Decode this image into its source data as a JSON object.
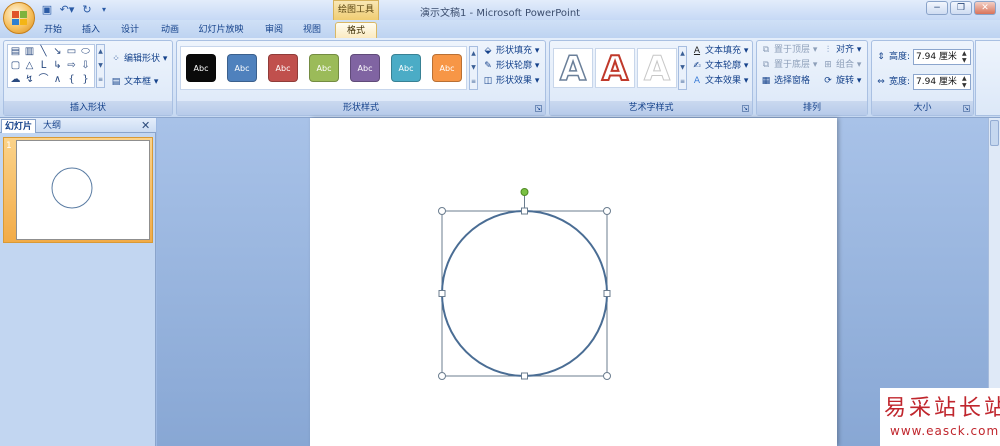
{
  "window": {
    "title": "演示文稿1 - Microsoft PowerPoint",
    "contextual_tab_group": "绘图工具",
    "controls": [
      "−",
      "❐",
      "✕"
    ]
  },
  "quick_access": [
    "save-icon",
    "undo-icon",
    "redo-icon"
  ],
  "tabs": [
    {
      "label": "开始"
    },
    {
      "label": "插入"
    },
    {
      "label": "设计"
    },
    {
      "label": "动画"
    },
    {
      "label": "幻灯片放映"
    },
    {
      "label": "审阅"
    },
    {
      "label": "视图"
    },
    {
      "label": "格式",
      "active": true
    }
  ],
  "ribbon": {
    "insert_shapes": {
      "label": "插入形状",
      "edit_shape": "编辑形状",
      "text_box": "文本框"
    },
    "shape_styles": {
      "label": "形状样式",
      "swatch_text": "Abc",
      "swatches": [
        "#0a0a0a",
        "#4f81bd",
        "#c0504d",
        "#9bbb59",
        "#8064a2",
        "#4bacc6",
        "#f79646"
      ],
      "fill": "形状填充",
      "outline": "形状轮廓",
      "effects": "形状效果"
    },
    "wordart_styles": {
      "label": "艺术字样式",
      "letter": "A",
      "text_fill": "文本填充",
      "text_outline": "文本轮廓",
      "text_effects": "文本效果"
    },
    "arrange": {
      "label": "排列",
      "bring_front": "置于顶层",
      "send_back": "置于底层",
      "selection_pane": "选择窗格",
      "align": "对齐",
      "group": "组合",
      "rotate": "旋转"
    },
    "size": {
      "label": "大小",
      "height_label": "高度:",
      "height_value": "7.94 厘米",
      "width_label": "宽度:",
      "width_value": "7.94 厘米"
    }
  },
  "left_panel": {
    "tab_slides": "幻灯片",
    "tab_outline": "大纲",
    "slide_number": "1",
    "close": "✕"
  },
  "watermark": {
    "text": "易采站长站",
    "url": "www.easck.com"
  },
  "colors": {
    "circle_stroke": "#4a6d94",
    "rotate_handle": "#7ac143",
    "accent_tab": "#fbeac1"
  }
}
